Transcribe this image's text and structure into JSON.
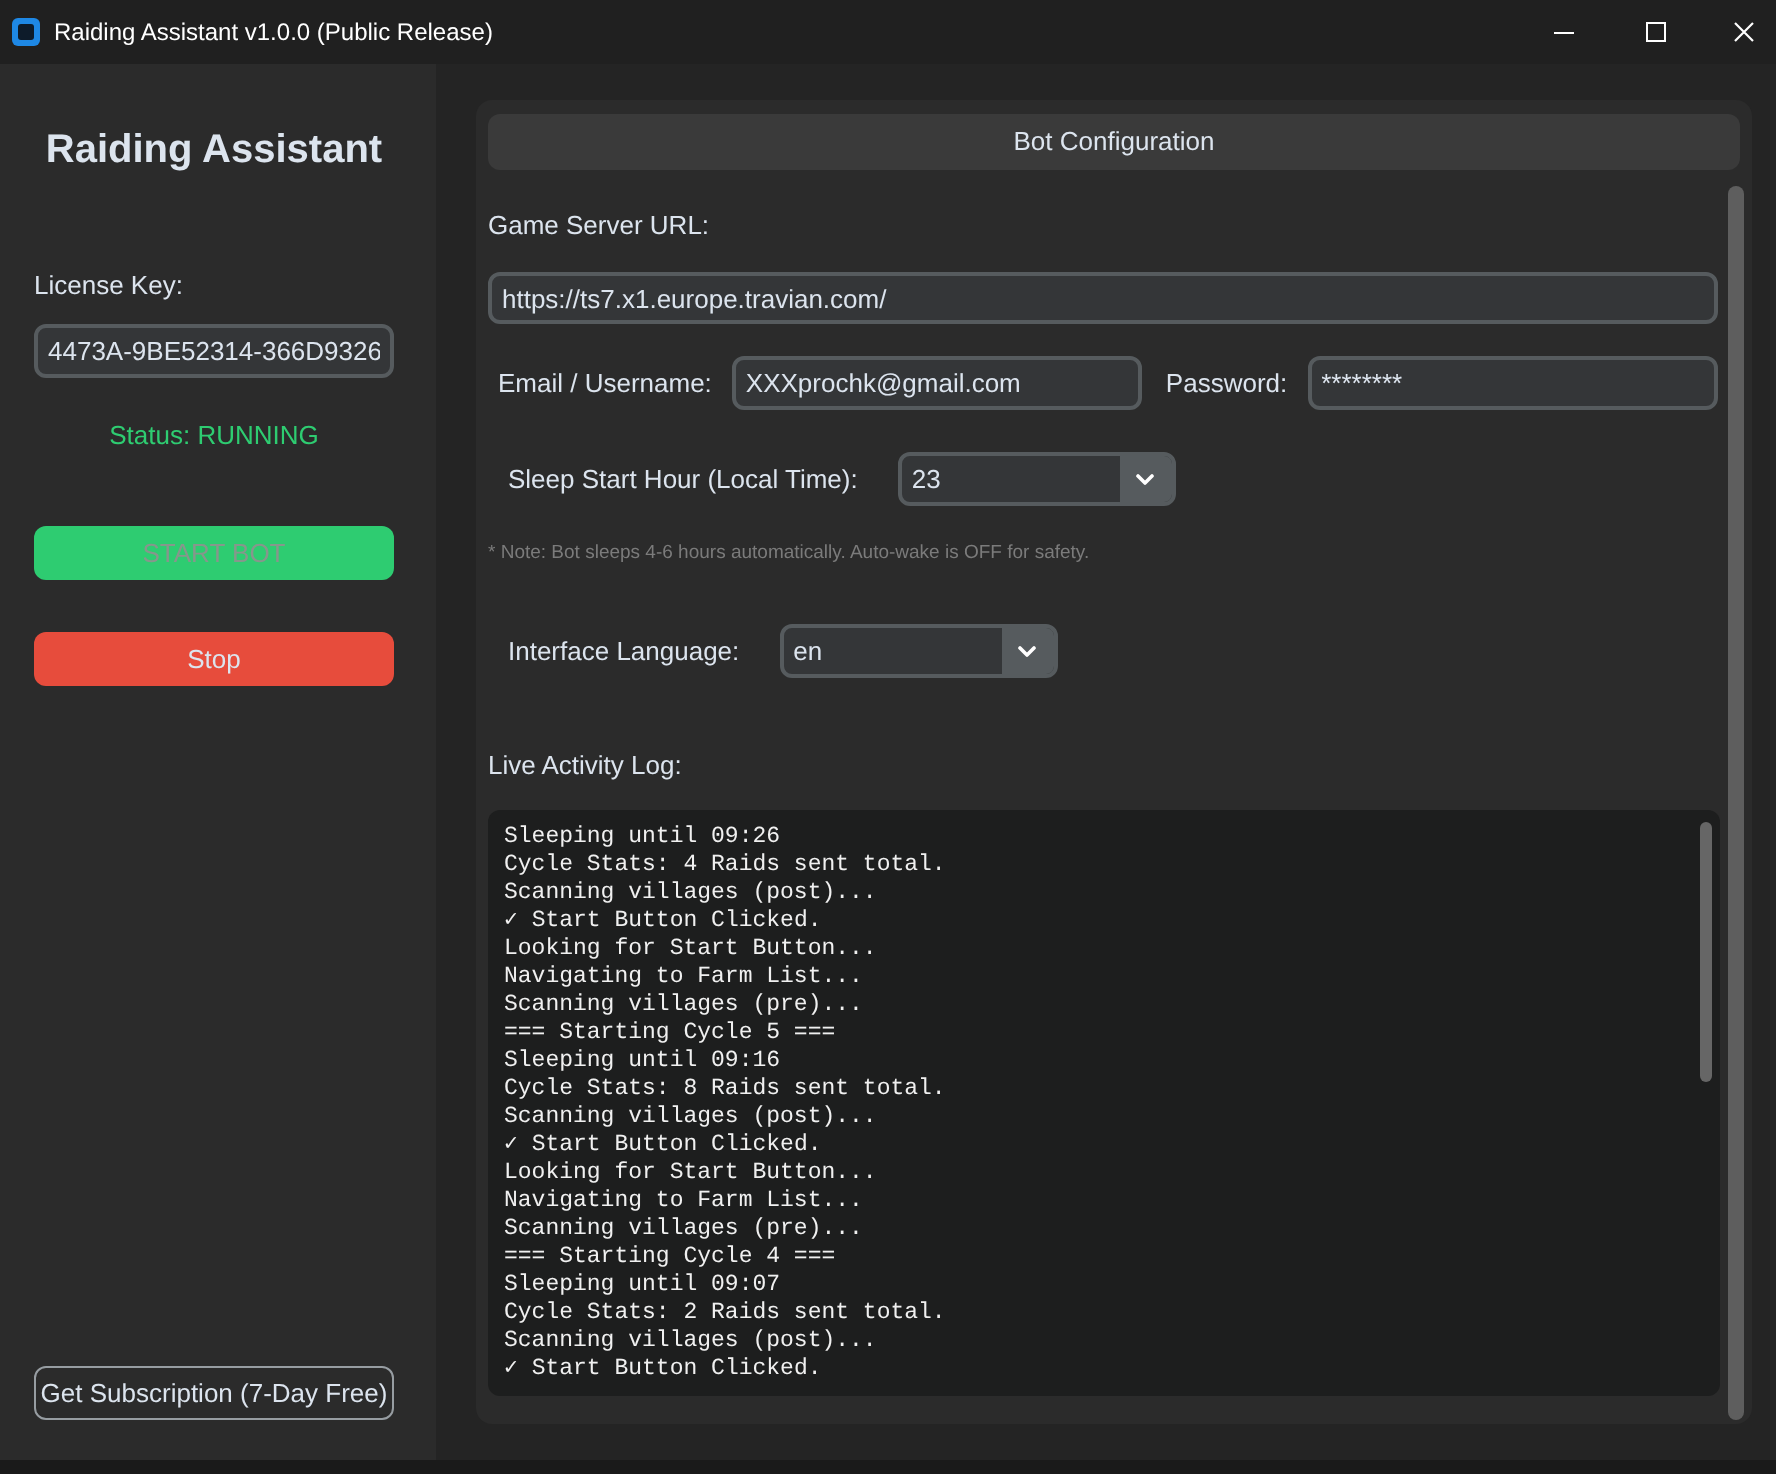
{
  "window": {
    "title": "Raiding Assistant v1.0.0 (Public Release)"
  },
  "sidebar": {
    "title": "Raiding Assistant",
    "license": {
      "label": "License Key:",
      "value": "4473A-9BE52314-366D9326"
    },
    "status": "Status: RUNNING",
    "buttons": [
      {
        "kind": "start",
        "label": "START BOT",
        "disabled": true
      },
      {
        "kind": "stop",
        "label": "Stop",
        "disabled": false
      }
    ],
    "subscription_button": "Get Subscription (7-Day Free)"
  },
  "config": {
    "header": "Bot Configuration",
    "server_url": {
      "label": "Game Server URL:",
      "value": "https://ts7.x1.europe.travian.com/"
    },
    "email": {
      "label": "Email / Username:",
      "value": "XXXprochk@gmail.com"
    },
    "password": {
      "label": "Password:",
      "value": "********"
    },
    "sleep_hour": {
      "label": "Sleep Start Hour (Local Time):",
      "value": "23"
    },
    "note": "* Note: Bot sleeps 4-6 hours automatically. Auto-wake is OFF for safety.",
    "language": {
      "label": "Interface Language:",
      "value": "en"
    }
  },
  "log": {
    "label": "Live Activity Log:",
    "lines": [
      "Sleeping until 09:26",
      "Cycle Stats: 4 Raids sent total.",
      "Scanning villages (post)...",
      "✓ Start Button Clicked.",
      "Looking for Start Button...",
      "Navigating to Farm List...",
      "Scanning villages (pre)...",
      "=== Starting Cycle 5 ===",
      "Sleeping until 09:16",
      "Cycle Stats: 8 Raids sent total.",
      "Scanning villages (post)...",
      "✓ Start Button Clicked.",
      "Looking for Start Button...",
      "Navigating to Farm List...",
      "Scanning villages (pre)...",
      "=== Starting Cycle 4 ===",
      "Sleeping until 09:07",
      "Cycle Stats: 2 Raids sent total.",
      "Scanning villages (post)...",
      "✓ Start Button Clicked."
    ]
  }
}
